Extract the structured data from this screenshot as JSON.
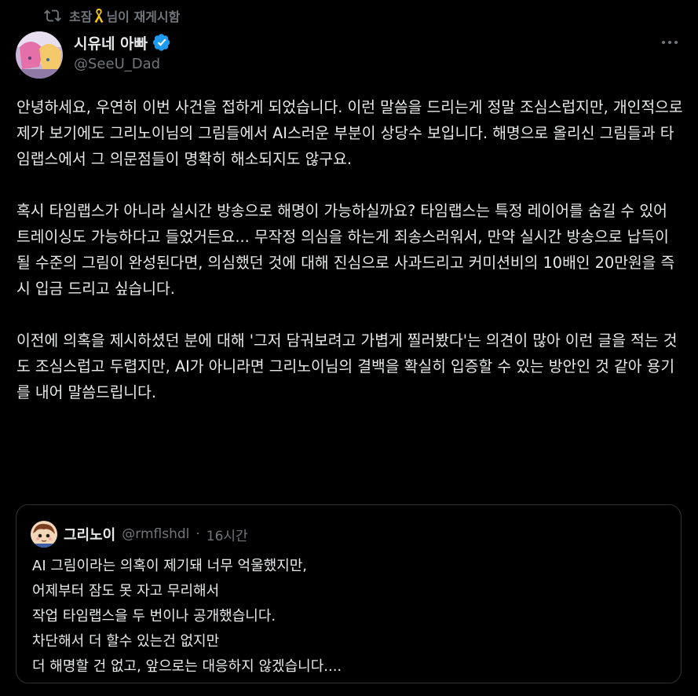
{
  "repost": {
    "icon": "repost-icon",
    "name_part1": "초잠",
    "ribbon": "yellow-ribbon-icon",
    "suffix": "님이 재게시함"
  },
  "author": {
    "name": "시유네 아빠",
    "handle": "@SeeU_Dad",
    "verified_color": "#1d9bf0"
  },
  "body": {
    "p1": "안녕하세요, 우연히 이번 사건을 접하게 되었습니다. 이런 말씀을 드리는게 정말 조심스럽지만, 개인적으로 제가 보기에도 그리노이님의 그림들에서 AI스러운 부분이 상당수 보입니다. 해명으로 올리신 그림들과 타임랩스에서 그 의문점들이 명확히 해소되지도 않구요.",
    "p2": "혹시 타임랩스가 아니라 실시간 방송으로 해명이 가능하실까요? 타임랩스는 특정 레이어를 숨길 수 있어 트레이싱도 가능하다고 들었거든요... 무작정 의심을 하는게 죄송스러워서, 만약 실시간 방송으로 납득이 될 수준의 그림이 완성된다면, 의심했던 것에 대해 진심으로 사과드리고 커미션비의 10배인 20만원을 즉시 입금 드리고 싶습니다.",
    "p3": "이전에 의혹을 제시하셨던 분에 대해 '그저 담궈보려고 가볍게 찔러봤다'는 의견이 많아 이런 글을 적는 것도 조심스럽고 두렵지만, AI가 아니라면 그리노이님의 결백을 확실히 입증할 수 있는 방안인 것 같아 용기를 내어 말씀드립니다."
  },
  "quote": {
    "name": "그리노이",
    "handle": "@rmflshdl",
    "separator": "·",
    "time": "16시간",
    "lines": [
      "AI 그림이라는 의혹이 제기돼 너무 억울했지만,",
      "어제부터 잠도 못 자고 무리해서",
      "작업 타임랩스을 두 번이나 공개했습니다.",
      "차단해서 더 할수 있는건 없지만",
      "더 해명할 건 없고, 앞으로는 대응하지 않겠습니다...."
    ]
  },
  "colors": {
    "background": "#000000",
    "text": "#e7e9ea",
    "muted": "#71767b",
    "border": "#2f3336",
    "accent": "#1d9bf0"
  }
}
